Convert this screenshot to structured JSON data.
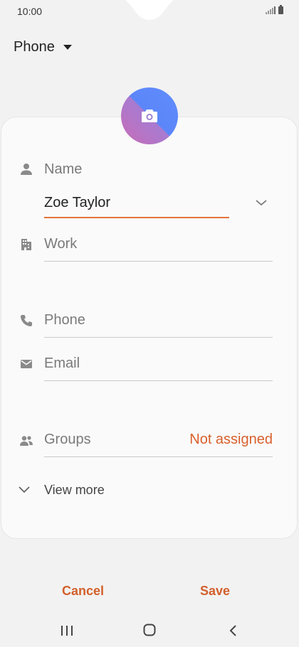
{
  "status_bar": {
    "time": "10:00"
  },
  "account_selector": {
    "label": "Phone"
  },
  "form": {
    "name": {
      "label": "Name",
      "value": "Zoe Taylor"
    },
    "work": {
      "placeholder": "Work"
    },
    "phone": {
      "placeholder": "Phone"
    },
    "email": {
      "placeholder": "Email"
    },
    "groups": {
      "label": "Groups",
      "value": "Not assigned"
    },
    "view_more": "View more"
  },
  "actions": {
    "cancel": "Cancel",
    "save": "Save"
  },
  "colors": {
    "accent": "#d35f2b",
    "background": "#f2f2f2",
    "card": "#fafafa"
  },
  "icons": [
    "person-icon",
    "building-icon",
    "phone-icon",
    "email-icon",
    "groups-icon",
    "camera-icon",
    "chevron-down-icon",
    "recents-icon",
    "home-icon",
    "back-icon"
  ]
}
